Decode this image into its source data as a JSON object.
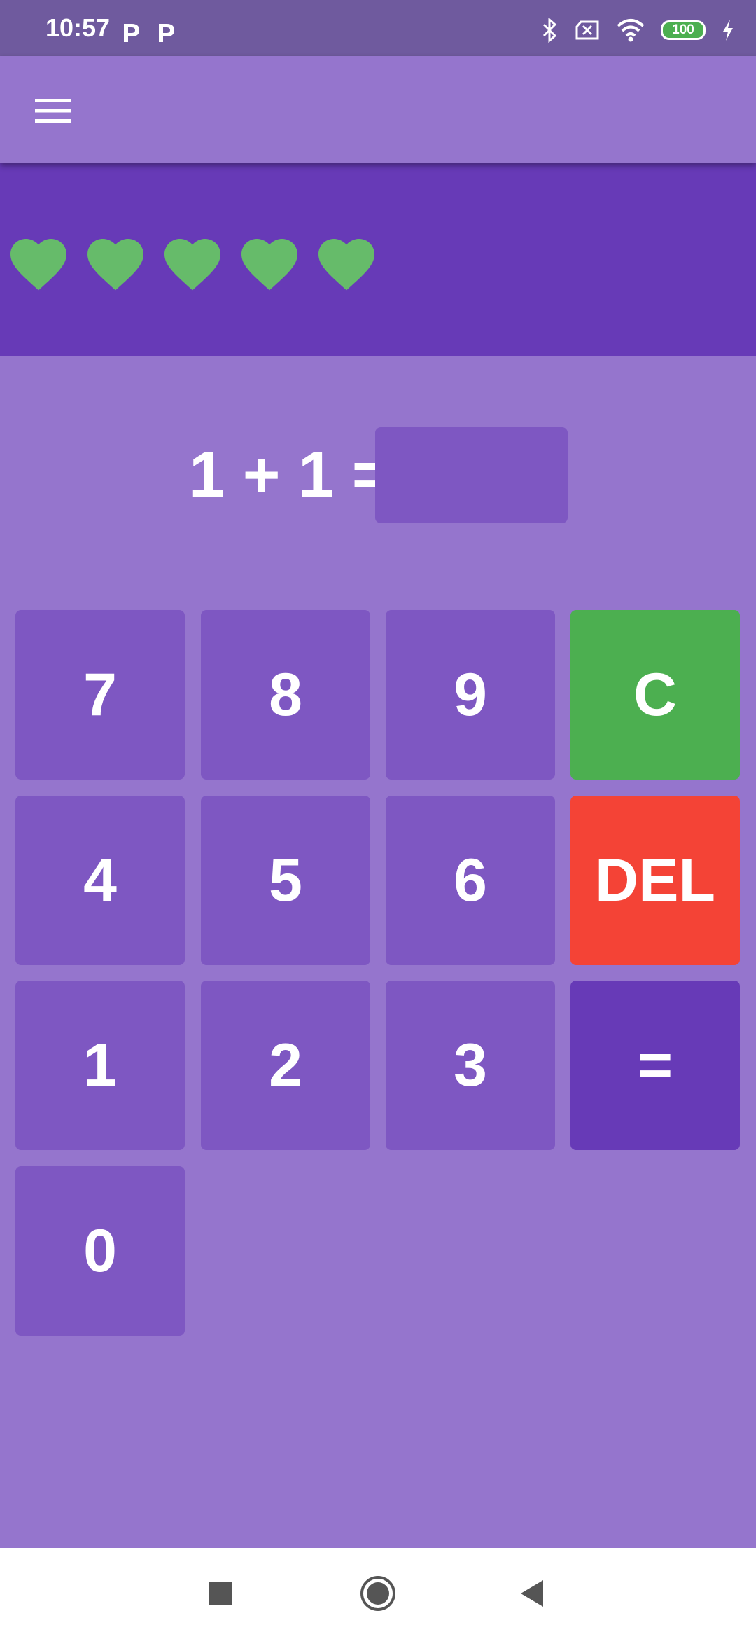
{
  "status_bar": {
    "time": "10:57",
    "notification_icons": [
      "p-icon",
      "p-icon"
    ],
    "battery_level": "100",
    "icons": [
      "bluetooth-icon",
      "no-sim-icon",
      "wifi-icon",
      "battery-icon",
      "charging-icon"
    ]
  },
  "app_bar": {
    "menu_icon": "hamburger-menu-icon"
  },
  "lives": {
    "count": 5,
    "icon": "heart-icon",
    "color": "#66bb6a"
  },
  "equation": {
    "text": "1 + 1 =",
    "answer_value": ""
  },
  "keypad": {
    "row1": [
      "7",
      "8",
      "9",
      "C"
    ],
    "row2": [
      "4",
      "5",
      "6",
      "DEL"
    ],
    "row3": [
      "1",
      "2",
      "3",
      "="
    ],
    "row4": [
      "0"
    ]
  },
  "colors": {
    "background": "#9575cd",
    "status_bar": "#6f5a9e",
    "hearts_panel": "#673ab7",
    "key": "#7e57c2",
    "clear_key": "#4caf50",
    "delete_key": "#f44336",
    "equals_key": "#673ab7",
    "heart": "#66bb6a"
  },
  "nav_bar": {
    "icons": [
      "recents-square-icon",
      "home-circle-icon",
      "back-triangle-icon"
    ]
  }
}
